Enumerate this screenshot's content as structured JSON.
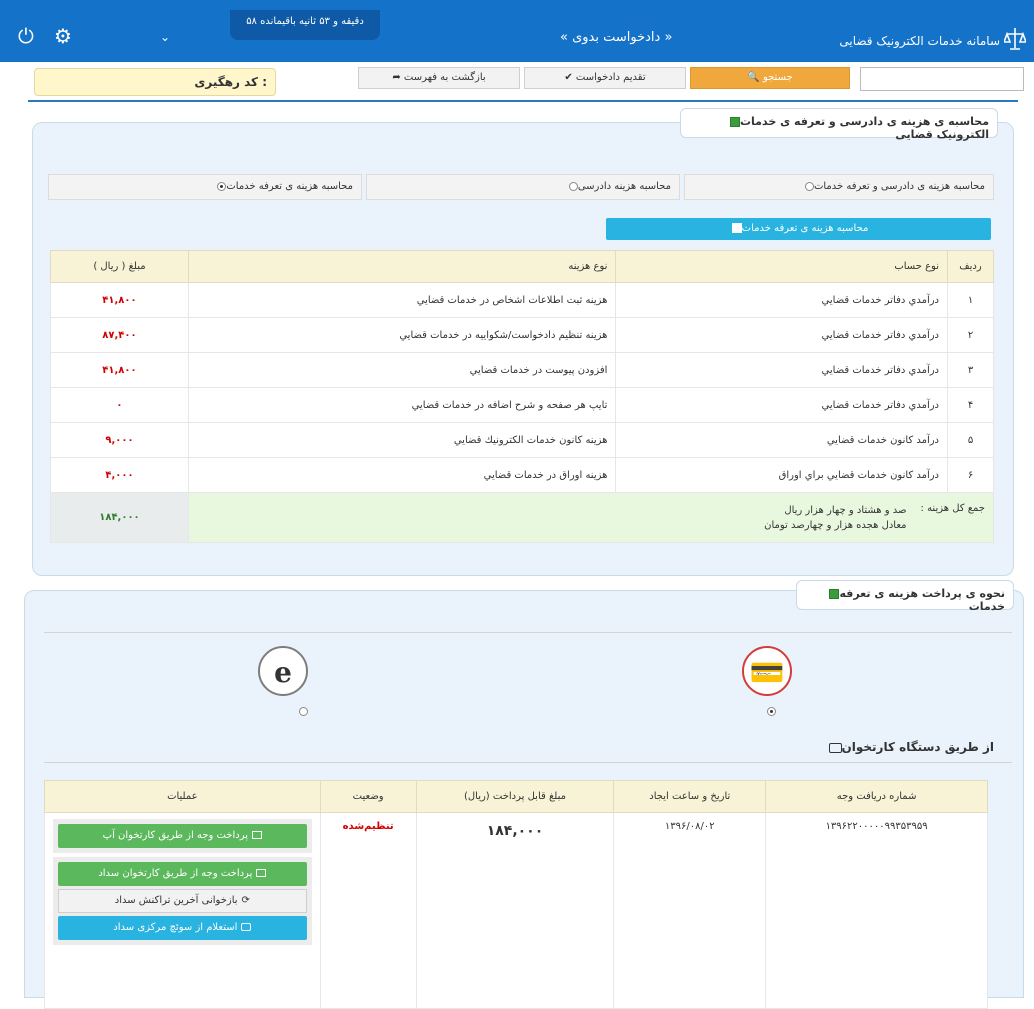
{
  "header": {
    "brand": "سامانه خدمات الکترونیک قضایی",
    "nav": "« دادخواست بدوی »",
    "timer": "۵۸ دقیقه و ۵۳ ثانیه باقیمانده",
    "chevron": "⌄",
    "power_icon": "⏻",
    "gear_icon": "⚙"
  },
  "toolbar": {
    "search_label": "🔍 جستجو",
    "submit_label": "✔ تقدیم دادخواست",
    "back_label": "➦ بازگشت به فهرست",
    "tracking_label": "کد رهگیری :",
    "search_value": ""
  },
  "calc_panel": {
    "title": "محاسبه ی هزینه ی دادرسی و تعرفه ی خدمات الکترونیک قضایی",
    "options": [
      "محاسبه هزینه ی دادرسی و تعرفه خدمات",
      "محاسبه هزینه دادرسی",
      "محاسبه هزینه ی تعرفه خدمات"
    ],
    "calc_button": "محاسبه هزینه ی تعرفه خدمات",
    "columns": [
      "ردیف",
      "نوع حساب",
      "نوع هزینه",
      "مبلغ ( ریال )"
    ],
    "rows": [
      {
        "no": "۱",
        "account": "درآمدي دفاتر خدمات قضايي",
        "fee": "هزينه ثبت اطلاعات اشخاص در خدمات قضايي",
        "amount": "۴۱,۸۰۰"
      },
      {
        "no": "۲",
        "account": "درآمدي دفاتر خدمات قضايي",
        "fee": "هزينه تنظيم دادخواست/شکواييه در خدمات قضايي",
        "amount": "۸۷,۴۰۰"
      },
      {
        "no": "۳",
        "account": "درآمدي دفاتر خدمات قضايي",
        "fee": "افزودن پيوست در خدمات قضايي",
        "amount": "۴۱,۸۰۰"
      },
      {
        "no": "۴",
        "account": "درآمدي دفاتر خدمات قضايي",
        "fee": "تايپ هر صفحه و شرح اضافه در خدمات قضايي",
        "amount": "۰"
      },
      {
        "no": "۵",
        "account": "درآمد کانون خدمات قضايي",
        "fee": "هزينه کانون خدمات الکترونيك قضايي",
        "amount": "۹,۰۰۰"
      },
      {
        "no": "۶",
        "account": "درآمد کانون خدمات قضايي براي اوراق",
        "fee": "هزينه اوراق در خدمات قضايي",
        "amount": "۴,۰۰۰"
      }
    ],
    "total_label": "جمع کل هزینه :",
    "total_words_rial": "صد و هشتاد و چهار هزار ریال",
    "total_words_toman": "معادل هجده هزار و چهارصد تومان",
    "total_amount": "۱۸۴,۰۰۰"
  },
  "payment_panel": {
    "title": "نحوه ی پرداخت هزینه ی تعرفه خدمات",
    "method_title": "از طریق دستگاه کارتخوان",
    "columns": [
      "شماره دریافت وجه",
      "تاریخ و ساعت ایجاد",
      "مبلغ قابل پرداخت (ریال)",
      "وضعیت",
      "عملیات"
    ],
    "row": {
      "receipt": "۱۳۹۶۲۲۰۰۰۰۰۹۹۳۵۳۹۵۹",
      "date": "۱۳۹۶/۰۸/۰۲",
      "amount": "۱۸۴,۰۰۰",
      "status": "تنظیم‌شده"
    },
    "buttons": {
      "pay_ap": "پرداخت وجه از طریق کارتخوان آپ",
      "pay_sadad": "پرداخت وجه از طریق کارتخوان سداد",
      "retrieve": "بازخوانی آخرین تراکنش سداد",
      "inquiry": "استعلام از سوئچ مرکزی سداد"
    },
    "icon_card": "💳",
    "icon_e": "e"
  }
}
